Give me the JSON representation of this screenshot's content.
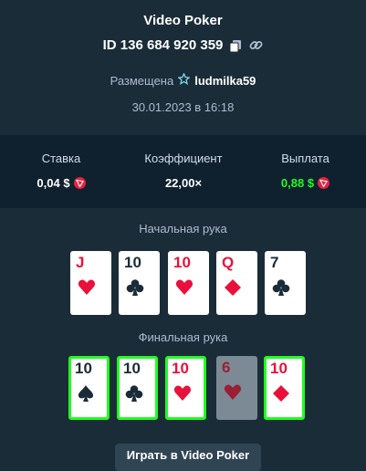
{
  "title": "Video Poker",
  "bet_id": "ID 136 684 920 359",
  "placed_label": "Размещена",
  "username": "ludmilka59",
  "datetime": "30.01.2023 в 16:18",
  "stats": {
    "bet_label": "Ставка",
    "bet_value": "0,04 $",
    "multiplier_label": "Коэффициент",
    "multiplier_value": "22,00×",
    "payout_label": "Выплата",
    "payout_value": "0,88 $"
  },
  "initial_hand_label": "Начальная рука",
  "initial_hand": [
    {
      "rank": "J",
      "suit": "hearts",
      "color": "red"
    },
    {
      "rank": "10",
      "suit": "clubs",
      "color": "black"
    },
    {
      "rank": "10",
      "suit": "hearts",
      "color": "red"
    },
    {
      "rank": "Q",
      "suit": "diamonds",
      "color": "red"
    },
    {
      "rank": "7",
      "suit": "clubs",
      "color": "black"
    }
  ],
  "final_hand_label": "Финальная рука",
  "final_hand": [
    {
      "rank": "10",
      "suit": "spades",
      "color": "black",
      "held": true
    },
    {
      "rank": "10",
      "suit": "clubs",
      "color": "black",
      "held": true
    },
    {
      "rank": "10",
      "suit": "hearts",
      "color": "red",
      "held": true
    },
    {
      "rank": "6",
      "suit": "hearts",
      "color": "red",
      "held": false
    },
    {
      "rank": "10",
      "suit": "diamonds",
      "color": "red",
      "held": true
    }
  ],
  "footer_button": "Играть в Video Poker",
  "colors": {
    "background": "#1a2c38",
    "panel": "#0f212e",
    "win_green": "#1fff20",
    "card_red": "#e9113c",
    "coin": "#e8213f"
  }
}
